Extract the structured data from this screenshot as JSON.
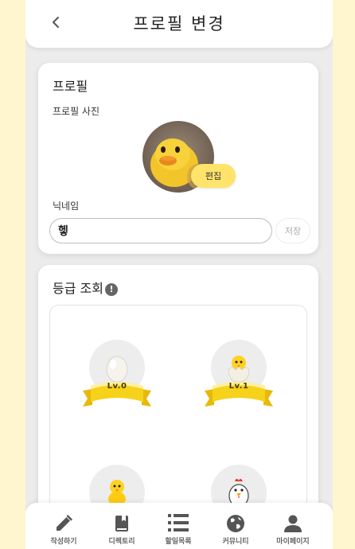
{
  "header": {
    "title": "프로필 변경",
    "back_icon": "chevron-left-icon"
  },
  "profile": {
    "title": "프로필",
    "photo_label": "프로필 사진",
    "edit_label": "편집",
    "nickname_label": "닉네임",
    "nickname_value": "헿",
    "save_label": "저장"
  },
  "grade": {
    "title": "등급 조회",
    "info_icon": "!",
    "items": [
      {
        "label": "Lv.0",
        "icon": "egg-icon"
      },
      {
        "label": "Lv.1",
        "icon": "hatching-chick-icon"
      },
      {
        "label": "",
        "icon": "chick-icon"
      },
      {
        "label": "",
        "icon": "chicken-icon"
      }
    ]
  },
  "nav": {
    "items": [
      {
        "label": "작성하기",
        "icon": "pencil-icon"
      },
      {
        "label": "디렉토리",
        "icon": "book-icon"
      },
      {
        "label": "할일목록",
        "icon": "list-icon"
      },
      {
        "label": "커뮤니티",
        "icon": "globe-icon"
      },
      {
        "label": "마이페이지",
        "icon": "person-icon"
      }
    ]
  },
  "colors": {
    "accent": "#ffe36a",
    "background": "#fff6cf",
    "surface": "#ececec"
  }
}
